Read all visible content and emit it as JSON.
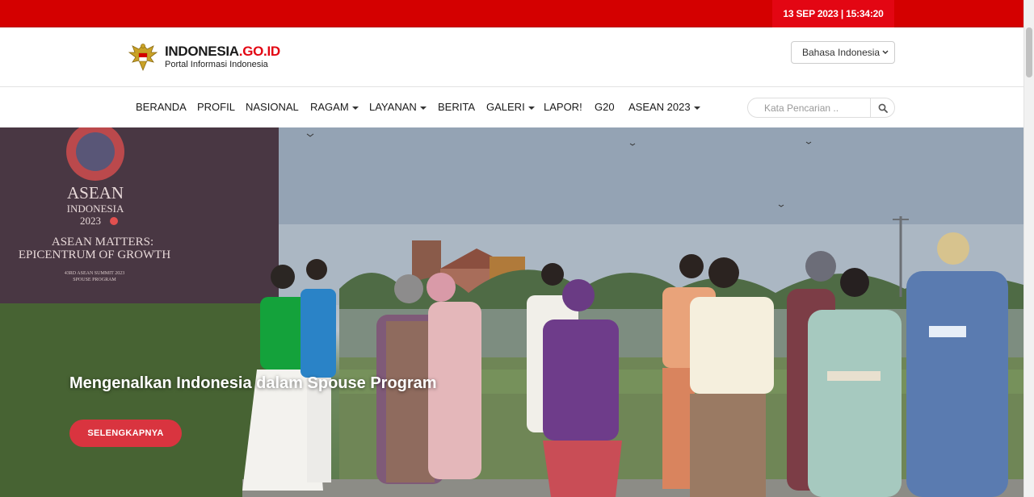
{
  "topbar": {
    "datetime": "13 SEP 2023 | 15:34:20"
  },
  "header": {
    "brand_main": "INDONESIA",
    "brand_accent": ".GO.ID",
    "brand_sub": "Portal Informasi Indonesia",
    "language": "Bahasa Indonesia"
  },
  "nav": {
    "items": [
      {
        "label": "BERANDA",
        "dropdown": false
      },
      {
        "label": "PROFIL",
        "dropdown": false
      },
      {
        "label": "NASIONAL",
        "dropdown": false
      },
      {
        "label": "RAGAM",
        "dropdown": true
      },
      {
        "label": "LAYANAN",
        "dropdown": true
      },
      {
        "label": "BERITA",
        "dropdown": false
      },
      {
        "label": "GALERI",
        "dropdown": true
      },
      {
        "label": "LAPOR!",
        "dropdown": false
      },
      {
        "label": "G20",
        "dropdown": false
      },
      {
        "label": "ASEAN 2023",
        "dropdown": true
      }
    ],
    "search_placeholder": "Kata Pencarian .."
  },
  "hero": {
    "banner": {
      "line1": "ASEAN",
      "line2": "INDONESIA",
      "line3": "2023",
      "line4": "ASEAN MATTERS:",
      "line5": "EPICENTRUM OF GROWTH",
      "line6": "43RD ASEAN SUMMIT 2023",
      "line7": "SPOUSE PROGRAM"
    },
    "title": "Mengenalkan Indonesia dalam Spouse Program",
    "button": "SELENGKAPNYA"
  },
  "colors": {
    "topbar": "#d40000",
    "datetime_bg": "#e30613",
    "brand_accent": "#e30613",
    "hero_button": "#d9343f"
  },
  "icons": [
    "garuda-emblem-icon",
    "chevron-down-icon",
    "search-icon"
  ]
}
